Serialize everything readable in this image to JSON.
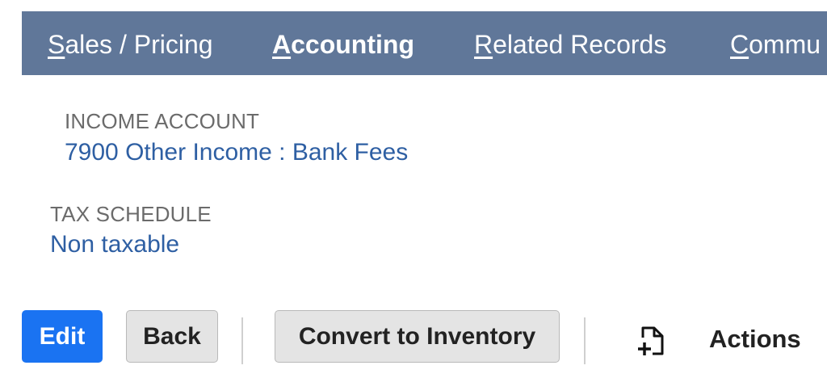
{
  "tabs": [
    {
      "accel": "S",
      "rest": "ales / Pricing",
      "active": false
    },
    {
      "accel": "A",
      "rest": "ccounting",
      "active": true
    },
    {
      "accel": "R",
      "rest": "elated Records",
      "active": false
    },
    {
      "accel": "C",
      "rest": "ommu",
      "active": false
    }
  ],
  "fields": {
    "income_account": {
      "label": "INCOME ACCOUNT",
      "value": "7900 Other Income : Bank Fees"
    },
    "tax_schedule": {
      "label": "TAX SCHEDULE",
      "value": "Non taxable"
    }
  },
  "buttons": {
    "edit": "Edit",
    "back": "Back",
    "convert": "Convert to Inventory",
    "actions": "Actions"
  },
  "icons": {
    "actions": "new-document-icon"
  },
  "colors": {
    "tab_bar": "#607799",
    "primary_button": "#1a73f2",
    "link": "#2e5fa3"
  }
}
